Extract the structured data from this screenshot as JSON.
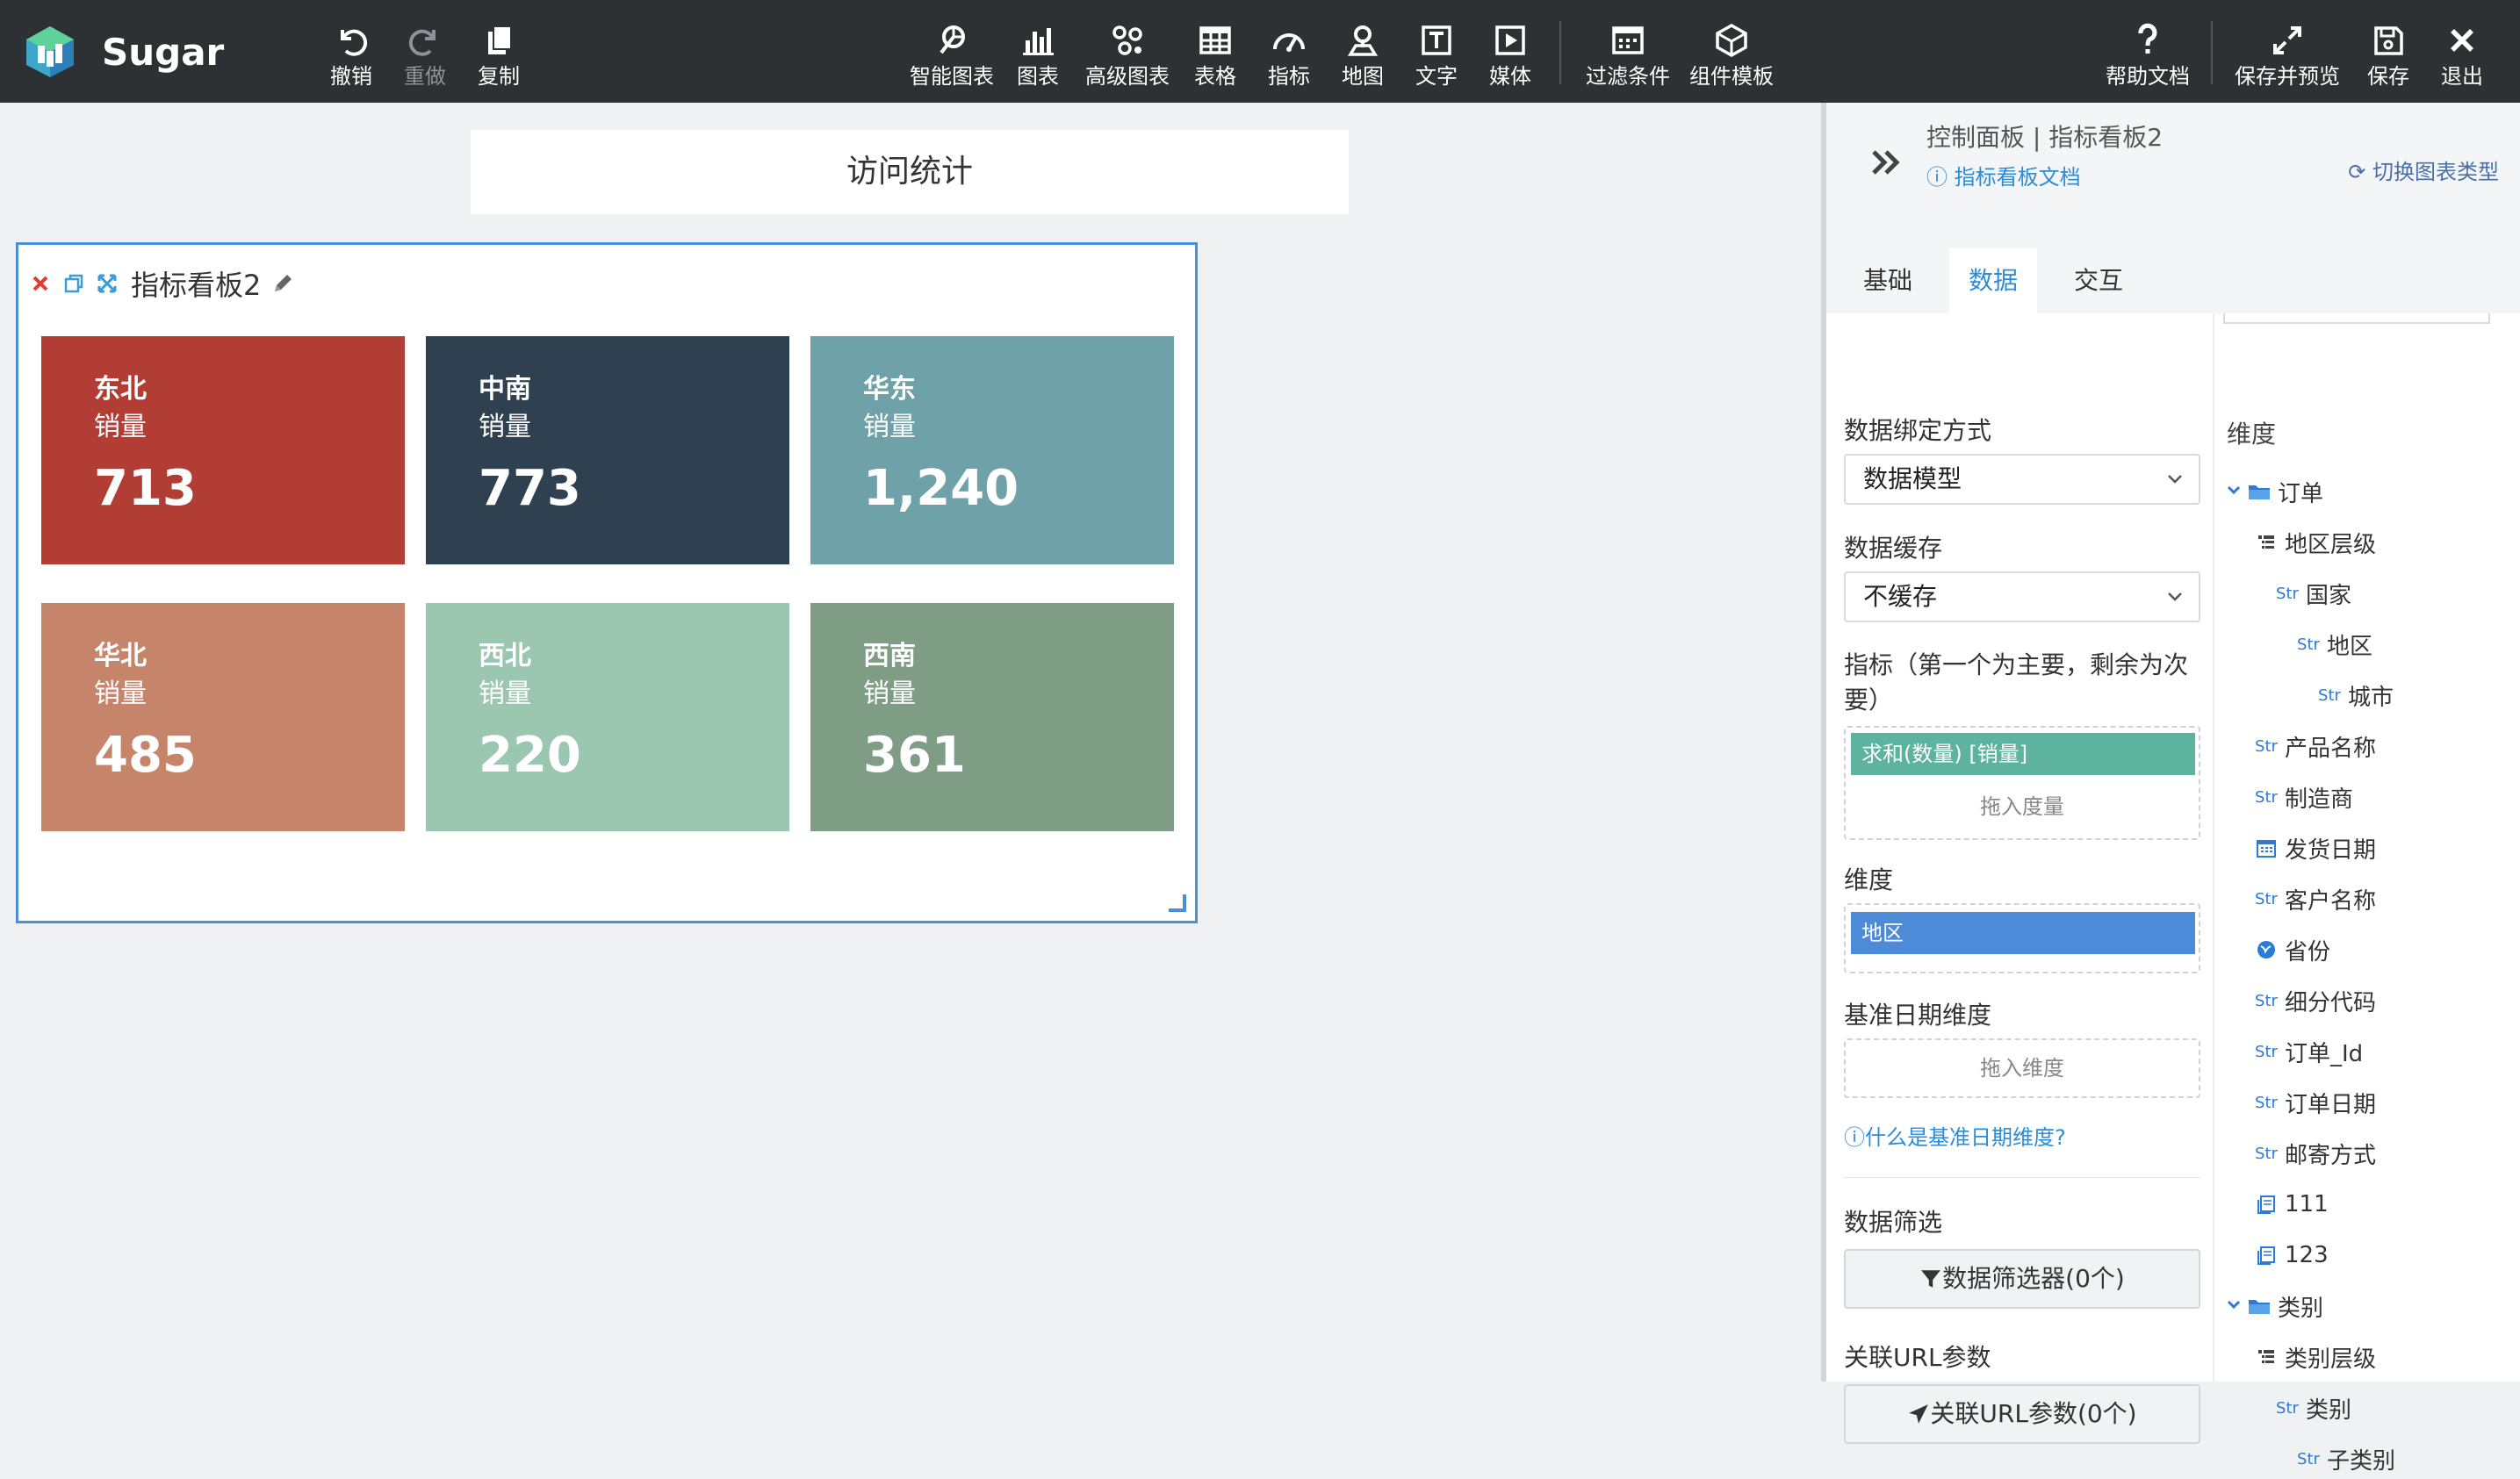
{
  "app": {
    "name": "Sugar"
  },
  "toolbar": {
    "left": [
      {
        "icon": "undo-icon",
        "label": "撤销"
      },
      {
        "icon": "redo-icon",
        "label": "重做"
      },
      {
        "icon": "copy-icon",
        "label": "复制"
      }
    ],
    "middle": [
      {
        "icon": "smart-chart-icon",
        "label": "智能图表"
      },
      {
        "icon": "bar-chart-icon",
        "label": "图表"
      },
      {
        "icon": "advanced-chart-icon",
        "label": "高级图表"
      },
      {
        "icon": "table-icon",
        "label": "表格"
      },
      {
        "icon": "gauge-icon",
        "label": "指标"
      },
      {
        "icon": "map-pin-icon",
        "label": "地图"
      },
      {
        "icon": "text-icon",
        "label": "文字"
      },
      {
        "icon": "media-icon",
        "label": "媒体"
      },
      {
        "icon": "filter-icon",
        "label": "过滤条件"
      },
      {
        "icon": "template-icon",
        "label": "组件模板"
      }
    ],
    "right": [
      {
        "icon": "help-icon",
        "label": "帮助文档"
      },
      {
        "icon": "save-preview-icon",
        "label": "保存并预览"
      },
      {
        "icon": "save-icon",
        "label": "保存"
      },
      {
        "icon": "exit-icon",
        "label": "退出"
      }
    ]
  },
  "canvas": {
    "page_title": "访问统计",
    "widget": {
      "title": "指标看板2",
      "tiles": [
        {
          "region": "东北",
          "metric": "销量",
          "value": "713",
          "color": "#b23d35"
        },
        {
          "region": "中南",
          "metric": "销量",
          "value": "773",
          "color": "#2f4050"
        },
        {
          "region": "华东",
          "metric": "销量",
          "value": "1,240",
          "color": "#6fa1a8"
        },
        {
          "region": "华北",
          "metric": "销量",
          "value": "485",
          "color": "#c6846b"
        },
        {
          "region": "西北",
          "metric": "销量",
          "value": "220",
          "color": "#9bc6af"
        },
        {
          "region": "西南",
          "metric": "销量",
          "value": "361",
          "color": "#7e9d84"
        }
      ]
    }
  },
  "panel": {
    "title": "控制面板 | 指标看板2",
    "doc_link": "指标看板文档",
    "switch_type": "切换图表类型",
    "tabs": [
      "基础",
      "数据",
      "交互"
    ],
    "active_tab": "数据",
    "binding_label": "数据绑定方式",
    "binding_value": "数据模型",
    "cache_label": "数据缓存",
    "cache_value": "不缓存",
    "metric_label_1": "指标（第一个为主要，剩余为次",
    "metric_label_2": "要）",
    "metric_pill": "求和(数量) [销量]",
    "metric_hint": "拖入度量",
    "dimension_label": "维度",
    "dimension_pill": "地区",
    "base_date_label": "基准日期维度",
    "base_date_hint": "拖入维度",
    "base_date_help": "什么是基准日期维度?",
    "filter_label": "数据筛选",
    "filter_button": "数据筛选器(0个)",
    "url_label": "关联URL参数",
    "url_button": "关联URL参数(0个)"
  },
  "dims": {
    "title": "维度",
    "items": [
      {
        "type": "folder",
        "label": "订单",
        "indent": 0
      },
      {
        "type": "hierarchy",
        "label": "地区层级",
        "indent": 1
      },
      {
        "type": "Str",
        "label": "国家",
        "indent": 2
      },
      {
        "type": "Str",
        "label": "地区",
        "indent": 3
      },
      {
        "type": "Str",
        "label": "城市",
        "indent": 4
      },
      {
        "type": "Str",
        "label": "产品名称",
        "indent": 1
      },
      {
        "type": "Str",
        "label": "制造商",
        "indent": 1
      },
      {
        "type": "date",
        "label": "发货日期",
        "indent": 1
      },
      {
        "type": "Str",
        "label": "客户名称",
        "indent": 1
      },
      {
        "type": "geo",
        "label": "省份",
        "indent": 1
      },
      {
        "type": "Str",
        "label": "细分代码",
        "indent": 1
      },
      {
        "type": "Str",
        "label": "订单_Id",
        "indent": 1
      },
      {
        "type": "Str",
        "label": "订单日期",
        "indent": 1
      },
      {
        "type": "Str",
        "label": "邮寄方式",
        "indent": 1
      },
      {
        "type": "calc",
        "label": "111",
        "indent": 1
      },
      {
        "type": "calc",
        "label": "123",
        "indent": 1
      },
      {
        "type": "folder",
        "label": "类别",
        "indent": 0
      },
      {
        "type": "hierarchy",
        "label": "类别层级",
        "indent": 1
      },
      {
        "type": "Str",
        "label": "类别",
        "indent": 2
      },
      {
        "type": "Str",
        "label": "子类别",
        "indent": 3
      }
    ]
  },
  "colors": {
    "topbar": "#2d3134",
    "accent": "#2b8cd8",
    "metric_pill": "#5db39e",
    "dimension_pill": "#4d8ad8",
    "close_red": "#e03c31"
  }
}
